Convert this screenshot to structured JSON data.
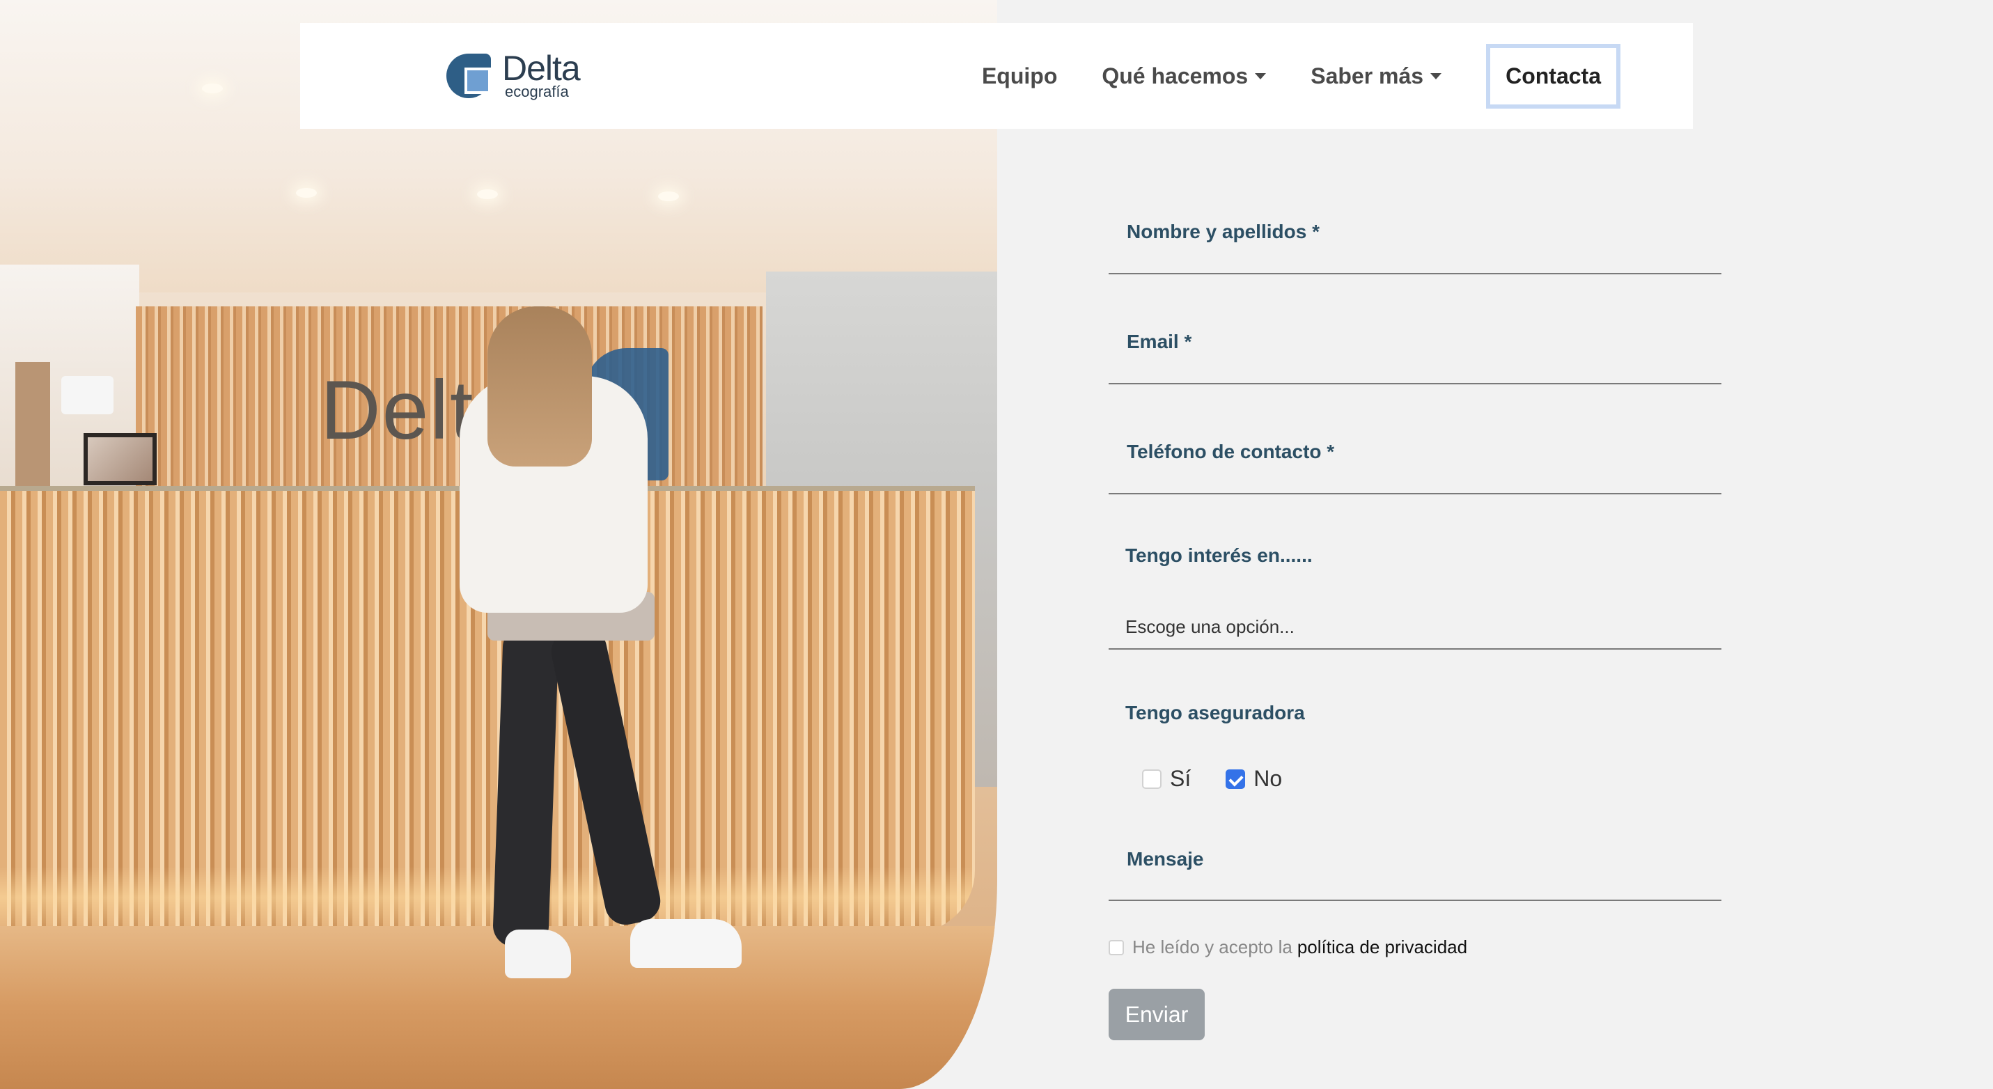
{
  "brand": {
    "name": "Delta",
    "subtitle": "ecografía"
  },
  "nav": {
    "items": [
      {
        "label": "Equipo",
        "dropdown": false
      },
      {
        "label": "Qué hacemos",
        "dropdown": true
      },
      {
        "label": "Saber más",
        "dropdown": true
      }
    ],
    "active": {
      "label": "Contacta"
    }
  },
  "photo": {
    "sign_text": "Delt"
  },
  "form": {
    "name_label": "Nombre y apellidos *",
    "email_label": "Email *",
    "phone_label": "Teléfono de contacto *",
    "interest_label": "Tengo interés en......",
    "interest_value": "Escoge una opción...",
    "insurer_label": "Tengo aseguradora",
    "insurer_options": [
      {
        "label": "Sí",
        "checked": false
      },
      {
        "label": "No",
        "checked": true
      }
    ],
    "message_label": "Mensaje",
    "privacy_prefix": "He leído y acepto la",
    "privacy_link": "política de privacidad",
    "submit_label": "Enviar"
  },
  "colors": {
    "page_bg": "#f2f2f2",
    "label": "#2c4f64",
    "checkbox_checked": "#3472e8",
    "button_bg": "#9aa0a5",
    "active_nav_border": "#c7d9f4"
  }
}
